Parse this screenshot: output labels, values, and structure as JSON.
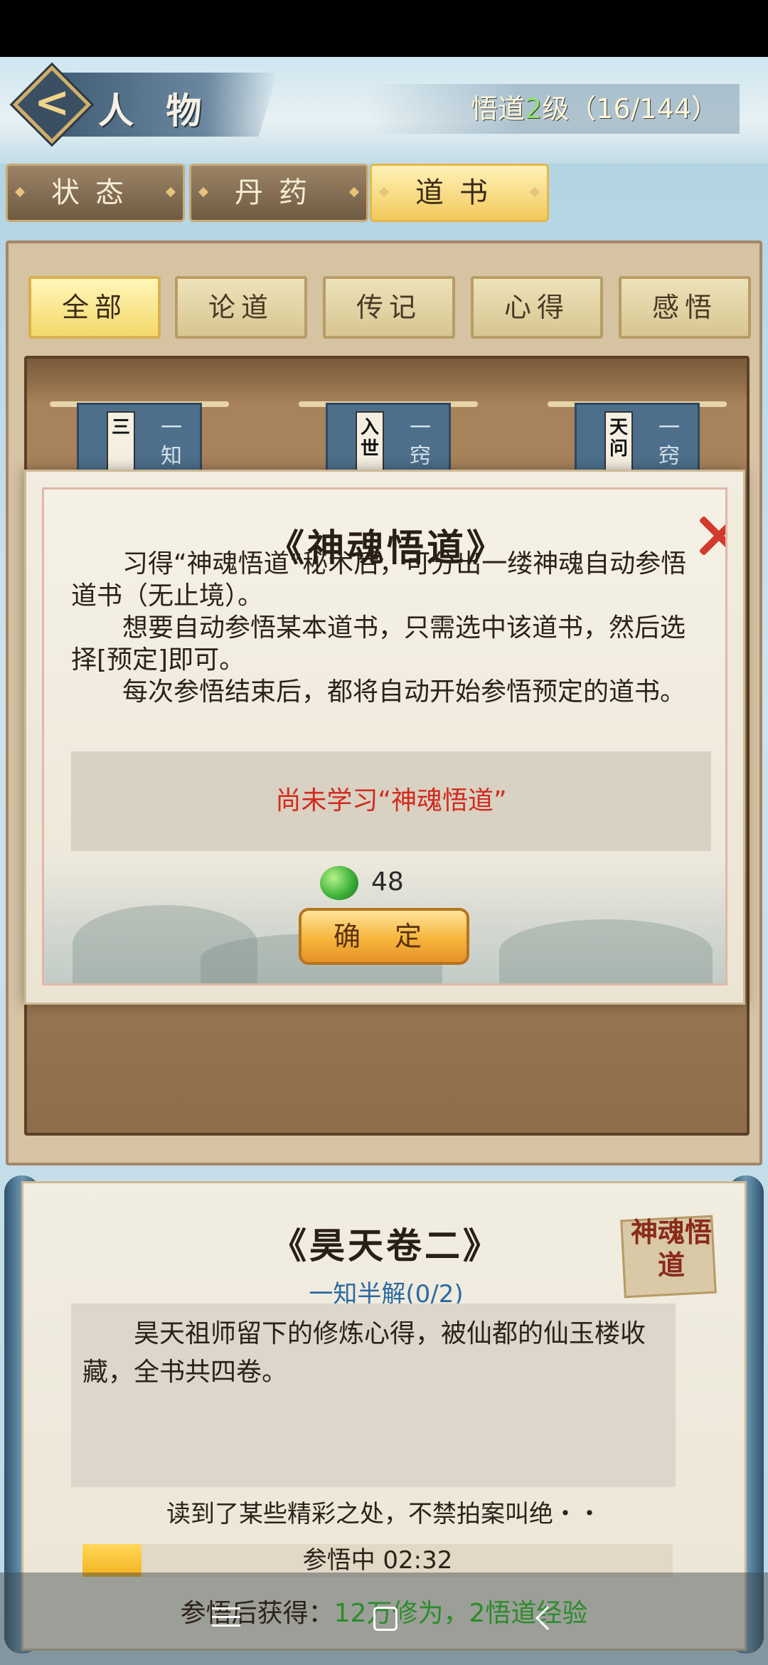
{
  "header": {
    "title": "人 物",
    "level_prefix": "悟道",
    "level_num": "2",
    "level_suffix": "级（16/144）"
  },
  "main_tabs": [
    {
      "label": "状态",
      "active": false
    },
    {
      "label": "丹药",
      "active": false
    },
    {
      "label": "道书",
      "active": true
    }
  ],
  "sub_tabs": [
    {
      "label": "全部",
      "active": true
    },
    {
      "label": "论道",
      "active": false
    },
    {
      "label": "传记",
      "active": false
    },
    {
      "label": "心得",
      "active": false
    },
    {
      "label": "感悟",
      "active": false
    }
  ],
  "books": [
    {
      "label": "三",
      "side": "一 知"
    },
    {
      "label": "入世",
      "side": "一 窍"
    },
    {
      "label": "天问",
      "side": "一 窍"
    }
  ],
  "modal": {
    "title": "《神魂悟道》",
    "paragraphs": [
      "习得“神魂悟道”秘术后，可分出一缕神魂自动参悟道书（无止境）。",
      "想要自动参悟某本道书，只需选中该道书，然后选择[预定]即可。",
      "每次参悟结束后，都将自动开始参悟预定的道书。"
    ],
    "notice": "尚未学习“神魂悟道”",
    "cost": "48",
    "confirm_label": "确 定"
  },
  "book_detail": {
    "title": "《昊天卷二》",
    "level": "一知半解(0/2)",
    "seal_text": "神魂悟道",
    "description": "昊天祖师留下的修炼心得，被仙都的仙玉楼收藏，全书共四卷。",
    "flavor": "读到了某些精彩之处，不禁拍案叫绝・・",
    "progress_text": "参悟中 02:32",
    "progress_value": 0.1,
    "reward_prefix": "参悟后获得：",
    "reward_highlight": "12万修为，2悟道经验"
  },
  "colors": {
    "accent_gold": "#f4d86a",
    "notice_red": "#d22a1e",
    "reward_green": "#2b8c2b",
    "level_link_blue": "#2a6aa2"
  },
  "icons": [
    "back-arrow-icon",
    "close-icon",
    "jade-currency-icon",
    "menu-icon",
    "home-icon",
    "back-icon"
  ]
}
